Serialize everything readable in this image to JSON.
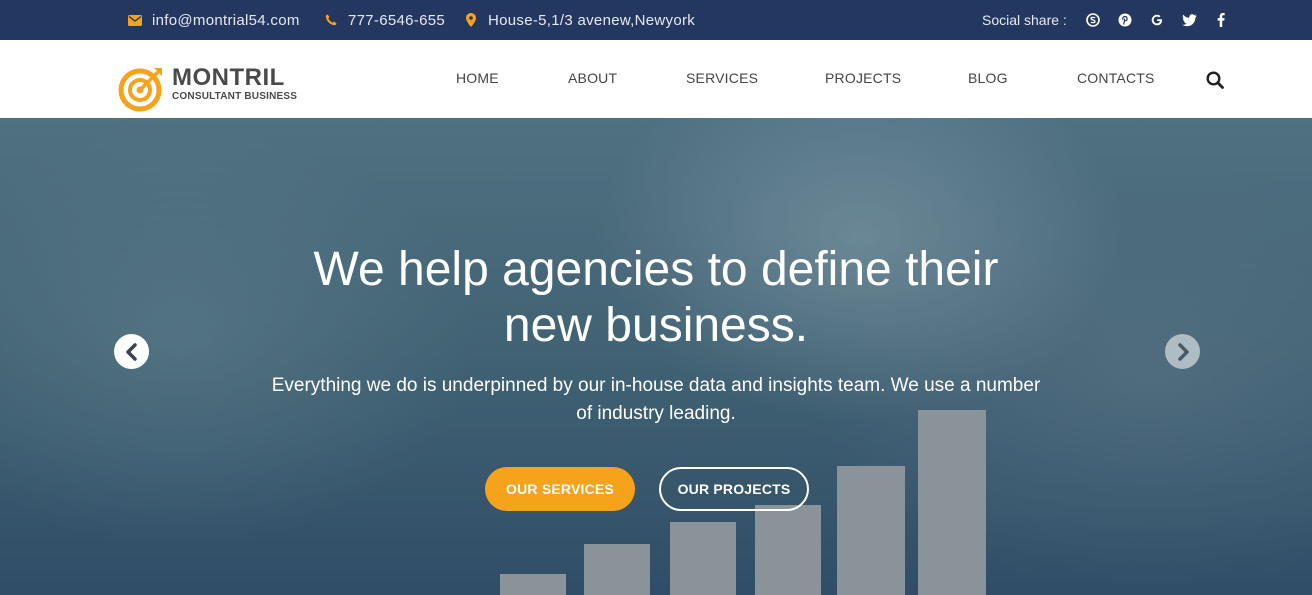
{
  "topbar": {
    "email": "info@montrial54.com",
    "phone": "777-6546-655",
    "address": "House-5,1/3 avenew,Newyork",
    "social_label": "Social share :",
    "icons": [
      "envelope-icon",
      "phone-icon",
      "map-pin-icon"
    ],
    "social_icons": [
      "skype-icon",
      "pinterest-icon",
      "google-icon",
      "twitter-icon",
      "facebook-icon"
    ],
    "accent": "#f7a21b",
    "background": "#243760"
  },
  "header": {
    "logo_title": "MONTRIL",
    "logo_subtitle": "CONSULTANT BUSINESS",
    "nav": [
      "HOME",
      "ABOUT",
      "SERVICES",
      "PROJECTS",
      "BLOG",
      "CONTACTS"
    ]
  },
  "hero": {
    "headline_line1": "We help agencies to define their",
    "headline_line2": "new business.",
    "subtext_line1": "Everything we do is underpinned by our in-house data and insights team. We use a number",
    "subtext_line2": "of industry leading.",
    "primary_button": "OUR SERVICES",
    "secondary_button": "OUR PROJECTS",
    "primary_color": "#f7a21b"
  }
}
